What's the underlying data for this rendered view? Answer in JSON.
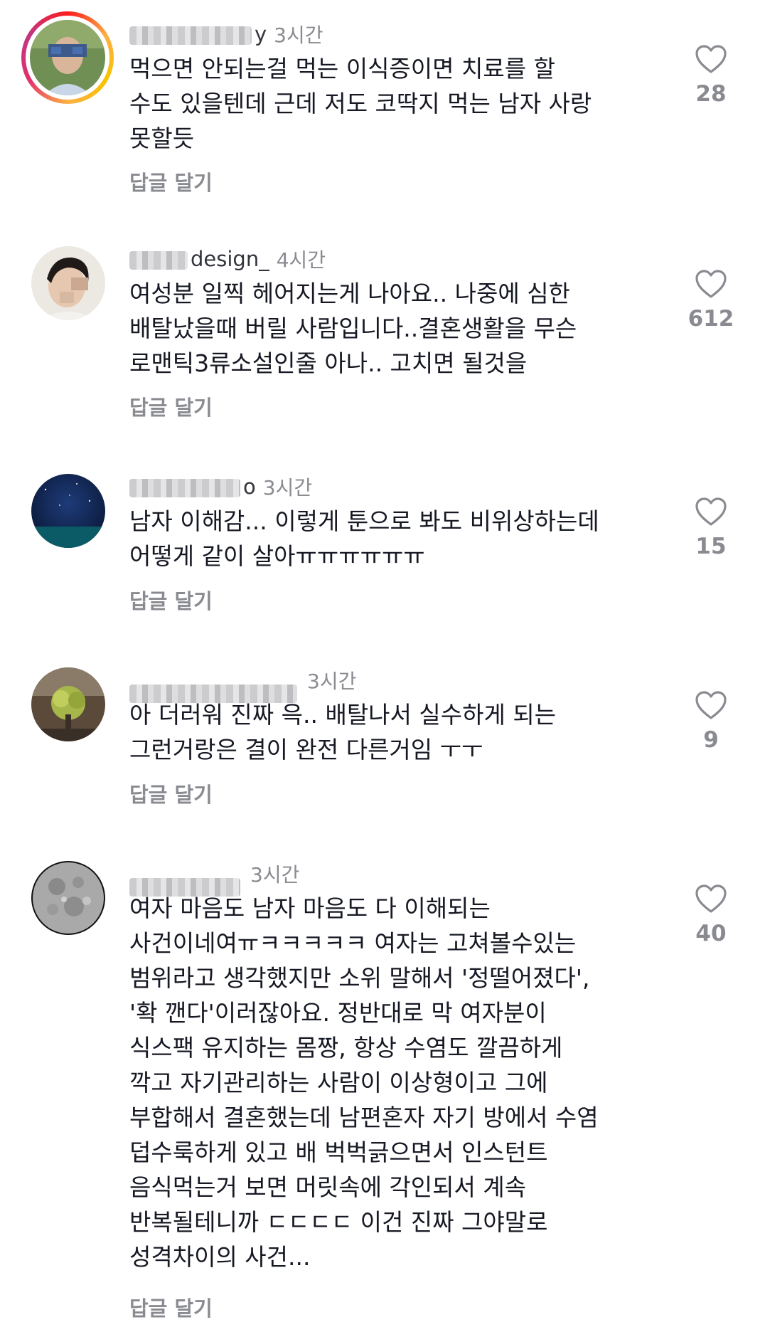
{
  "comments": [
    {
      "username": "y",
      "time": "3시간",
      "text": [
        "먹으면 안되는걸 먹는 이식증이면 치료를 할",
        "수도 있을텐데 근데 저도 코딱지 먹는 남자 사랑",
        "못할듯"
      ],
      "reply": "답글 달기",
      "likes": "28"
    },
    {
      "username": "design_",
      "time": "4시간",
      "text": [
        "여성분 일찍 헤어지는게 나아요.. 나중에 심한",
        "배탈났을때 버릴 사람입니다..결혼생활을 무슨",
        "로맨틱3류소설인줄 아나.. 고치면 될것을"
      ],
      "reply": "답글 달기",
      "likes": "612"
    },
    {
      "username": "o",
      "time": "3시간",
      "text": [
        "남자 이해감... 이렇게 툰으로 봐도 비위상하는데",
        "어떻게 같이 살아ㅠㅠㅠㅠㅠㅠ"
      ],
      "reply": "답글 달기",
      "likes": "15"
    },
    {
      "username": "",
      "time": "3시간",
      "text": [
        "아 더러워 진짜 윽.. 배탈나서 실수하게 되는",
        "그런거랑은 결이 완전 다른거임 ㅜㅜ"
      ],
      "reply": "답글 달기",
      "likes": "9"
    },
    {
      "username": "",
      "time": "3시간",
      "text": [
        "여자 마음도 남자 마음도 다 이해되는",
        "사건이네여ㅠㅋㅋㅋㅋㅋ 여자는 고쳐볼수있는",
        "범위라고 생각했지만 소위 말해서 '정떨어졌다',",
        "'확 깬다'이러잖아요. 정반대로 막 여자분이",
        "식스팩 유지하는 몸짱, 항상 수염도 깔끔하게",
        "깍고 자기관리하는 사람이 이상형이고 그에",
        "부합해서 결혼했는데 남편혼자 자기 방에서 수염",
        "덥수룩하게 있고 배 벅벅긁으면서 인스턴트",
        "음식먹는거 보면 머릿속에 각인되서 계속",
        "반복될테니까 ㄷㄷㄷㄷ 이건 진짜 그야말로",
        "성격차이의 사건..."
      ],
      "reply": "답글 달기",
      "likes": "40"
    }
  ]
}
